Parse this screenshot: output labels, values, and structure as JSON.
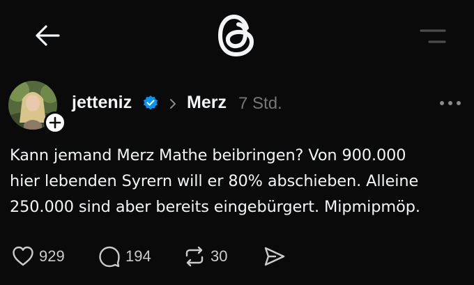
{
  "colors": {
    "background": "#0a0a0a",
    "text_primary": "#f3f5f7",
    "text_secondary": "#777777",
    "verified_blue": "#0095f6"
  },
  "topbar": {
    "back_icon": "arrow-left-icon",
    "logo_icon": "threads-logo-icon",
    "menu_icon": "menu-icon"
  },
  "post": {
    "author": "jetteniz",
    "verified": true,
    "community": "Merz",
    "timestamp": "7 Std.",
    "lines": [
      "Kann jemand Merz Mathe beibringen? Von 900.000",
      "hier lebenden Syrern will er 80% abschieben. Alleine",
      "250.000 sind aber bereits eingebürgert. Mipmipmöp."
    ]
  },
  "actions": {
    "likes": "929",
    "replies": "194",
    "reposts": "30"
  }
}
